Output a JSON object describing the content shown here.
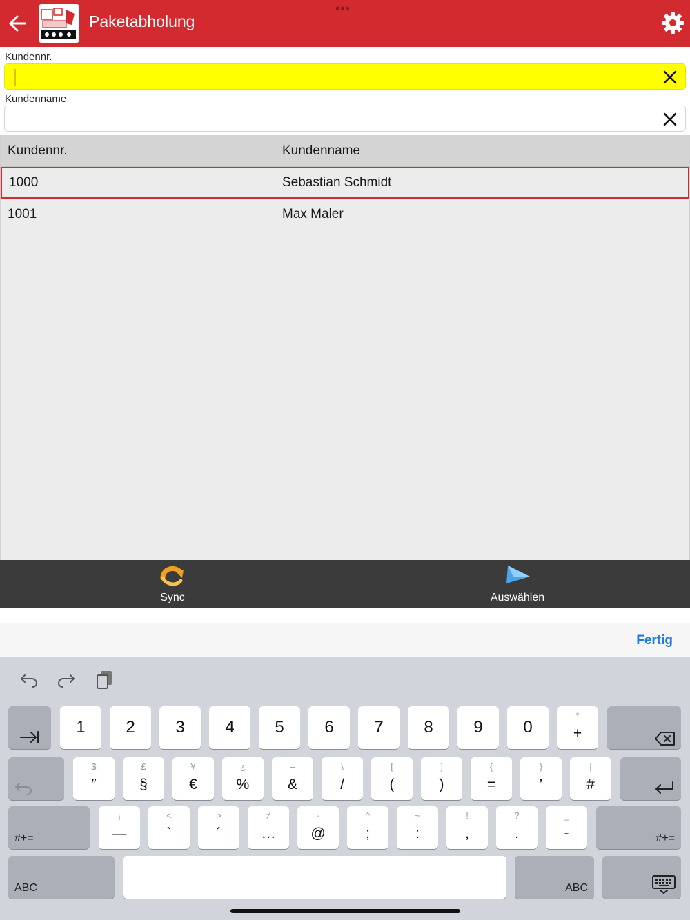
{
  "header": {
    "title": "Paketabholung",
    "back_icon": "arrow-left-icon",
    "menu_dots": "•••",
    "settings_icon": "gear-icon",
    "brand_color": "#d32a2f"
  },
  "form": {
    "customer_number": {
      "label": "Kundennr.",
      "value": "",
      "highlight_color": "#ffff00"
    },
    "customer_name": {
      "label": "Kundenname",
      "value": ""
    }
  },
  "table": {
    "columns": [
      "Kundennr.",
      "Kundenname"
    ],
    "rows": [
      {
        "number": "1000",
        "name": "Sebastian Schmidt",
        "selected": true
      },
      {
        "number": "1001",
        "name": "Max Maler",
        "selected": false
      }
    ]
  },
  "actions": {
    "sync": {
      "label": "Sync",
      "icon": "sync-arrow-icon"
    },
    "select": {
      "label": "Auswählen",
      "icon": "play-arrow-icon"
    }
  },
  "accessory": {
    "done_label": "Fertig"
  },
  "keyboard": {
    "row1": [
      {
        "main": "1"
      },
      {
        "main": "2"
      },
      {
        "main": "3"
      },
      {
        "main": "4"
      },
      {
        "main": "5"
      },
      {
        "main": "6"
      },
      {
        "main": "7"
      },
      {
        "main": "8"
      },
      {
        "main": "9"
      },
      {
        "main": "0"
      },
      {
        "sub": "*",
        "main": "+"
      }
    ],
    "row2": [
      {
        "sub": "$",
        "main": "″"
      },
      {
        "sub": "£",
        "main": "§"
      },
      {
        "sub": "¥",
        "main": "€"
      },
      {
        "sub": "¿",
        "main": "%"
      },
      {
        "sub": "–",
        "main": "&"
      },
      {
        "sub": "\\",
        "main": "/"
      },
      {
        "sub": "[",
        "main": "("
      },
      {
        "sub": "]",
        "main": ")"
      },
      {
        "sub": "{",
        "main": "="
      },
      {
        "sub": "}",
        "main": "’"
      },
      {
        "sub": "|",
        "main": "#"
      }
    ],
    "row3": [
      {
        "sub": "¡",
        "main": "—"
      },
      {
        "sub": "<",
        "main": "`"
      },
      {
        "sub": ">",
        "main": "´"
      },
      {
        "sub": "≠",
        "main": "…"
      },
      {
        "sub": "·",
        "main": "@"
      },
      {
        "sub": "^",
        "main": ";"
      },
      {
        "sub": "~",
        "main": ":"
      },
      {
        "sub": "!",
        "main": ","
      },
      {
        "sub": "?",
        "main": "."
      },
      {
        "sub": "_",
        "main": "-"
      }
    ],
    "symbols_label": "#+=",
    "abc_label": "ABC"
  }
}
